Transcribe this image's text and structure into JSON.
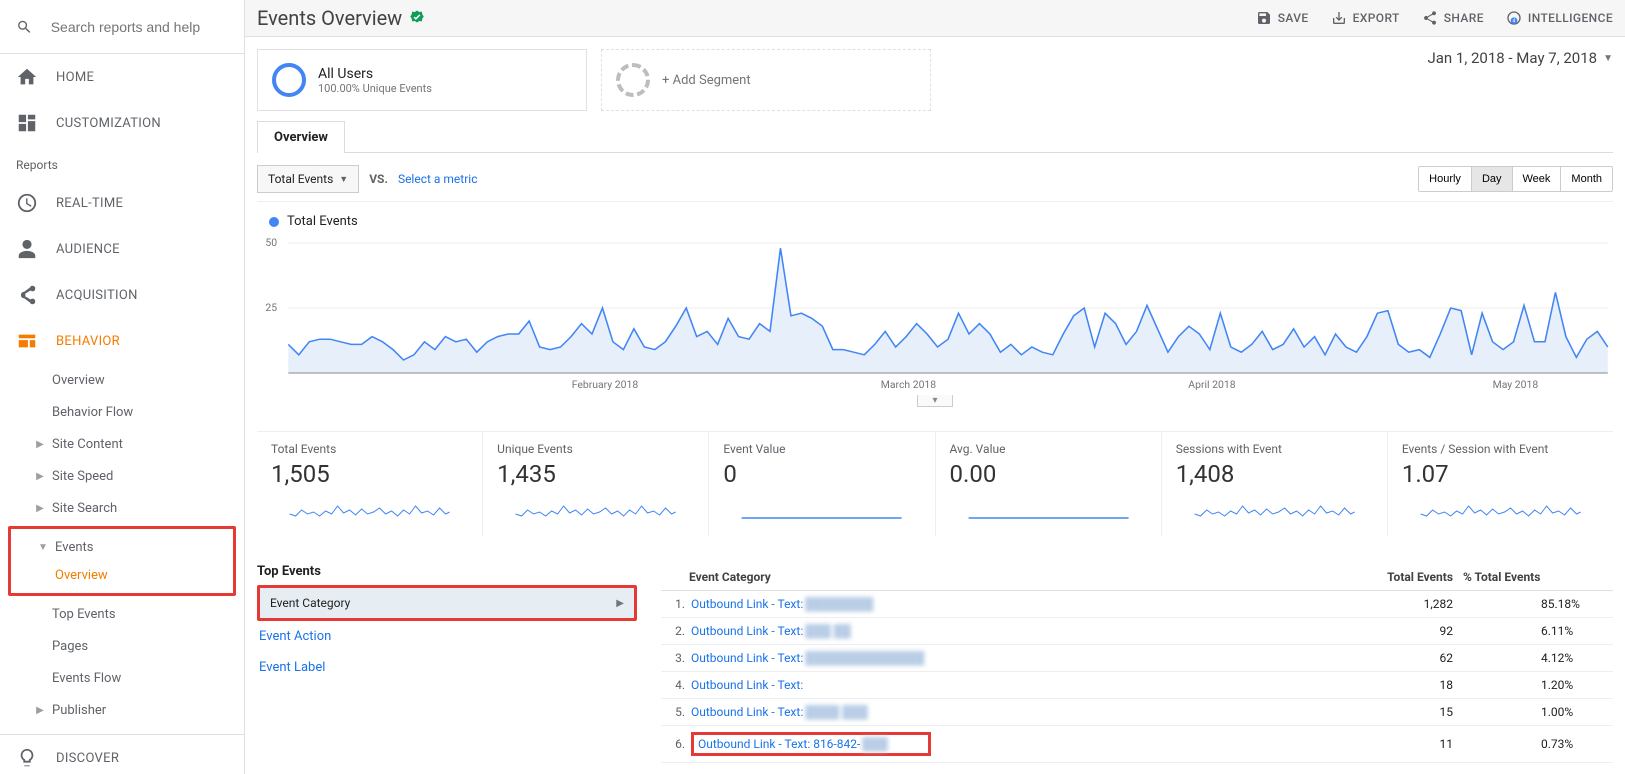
{
  "search": {
    "placeholder": "Search reports and help"
  },
  "nav": {
    "home": "HOME",
    "customization": "CUSTOMIZATION",
    "reports_label": "Reports",
    "realtime": "REAL-TIME",
    "audience": "AUDIENCE",
    "acquisition": "ACQUISITION",
    "behavior": "BEHAVIOR",
    "behavior_sub": {
      "overview": "Overview",
      "behavior_flow": "Behavior Flow",
      "site_content": "Site Content",
      "site_speed": "Site Speed",
      "site_search": "Site Search",
      "events": "Events",
      "events_overview": "Overview",
      "top_events": "Top Events",
      "pages": "Pages",
      "events_flow": "Events Flow",
      "publisher": "Publisher"
    },
    "discover": "DISCOVER"
  },
  "page": {
    "title": "Events Overview",
    "actions": {
      "save": "SAVE",
      "export": "EXPORT",
      "share": "SHARE",
      "intelligence": "INTELLIGENCE"
    }
  },
  "segments": {
    "all_users": "All Users",
    "all_users_sub": "100.00% Unique Events",
    "add": "+ Add Segment"
  },
  "date_range": "Jan 1, 2018 - May 7, 2018",
  "tab": "Overview",
  "controls": {
    "metric_dropdown": "Total Events",
    "vs": "VS.",
    "select_metric": "Select a metric",
    "granularity": {
      "hourly": "Hourly",
      "day": "Day",
      "week": "Week",
      "month": "Month"
    }
  },
  "chart": {
    "legend": "Total Events",
    "y_ticks": [
      "50",
      "25"
    ],
    "x_ticks": [
      "February 2018",
      "March 2018",
      "April 2018",
      "May 2018"
    ]
  },
  "metrics": [
    {
      "label": "Total Events",
      "value": "1,505"
    },
    {
      "label": "Unique Events",
      "value": "1,435"
    },
    {
      "label": "Event Value",
      "value": "0"
    },
    {
      "label": "Avg. Value",
      "value": "0.00"
    },
    {
      "label": "Sessions with Event",
      "value": "1,408"
    },
    {
      "label": "Events / Session with Event",
      "value": "1.07"
    }
  ],
  "top_events": {
    "title": "Top Events",
    "event_category": "Event Category",
    "event_action": "Event Action",
    "event_label": "Event Label"
  },
  "table": {
    "head": {
      "cat": "Event Category",
      "te": "Total Events",
      "pct": "% Total Events"
    },
    "rows": [
      {
        "n": "1.",
        "link": "Outbound Link - Text:",
        "blur": "████████",
        "te": "1,282",
        "pct": "85.18%",
        "bar": 85
      },
      {
        "n": "2.",
        "link": "Outbound Link - Text:",
        "blur": "███ ██",
        "te": "92",
        "pct": "6.11%",
        "bar": 6
      },
      {
        "n": "3.",
        "link": "Outbound Link - Text:",
        "blur": "██████████████",
        "te": "62",
        "pct": "4.12%",
        "bar": 4
      },
      {
        "n": "4.",
        "link": "Outbound Link - Text:",
        "blur": "",
        "te": "18",
        "pct": "1.20%",
        "bar": 2
      },
      {
        "n": "5.",
        "link": "Outbound Link - Text:",
        "blur": "████ ███",
        "te": "15",
        "pct": "1.00%",
        "bar": 2
      },
      {
        "n": "6.",
        "link": "Outbound Link - Text: 816-842-",
        "blur": "███",
        "te": "11",
        "pct": "0.73%",
        "bar": 2
      }
    ]
  },
  "chart_data": {
    "type": "line",
    "title": "Total Events",
    "ylabel": "Total Events",
    "ylim": [
      0,
      50
    ],
    "x_range": [
      "2018-01-01",
      "2018-05-07"
    ],
    "x_tick_labels": [
      "February 2018",
      "March 2018",
      "April 2018",
      "May 2018"
    ],
    "series": [
      {
        "name": "Total Events",
        "values": [
          11,
          7,
          12,
          13,
          13,
          12,
          11,
          11,
          14,
          12,
          9,
          5,
          7,
          12,
          9,
          14,
          12,
          13,
          8,
          12,
          14,
          15,
          15,
          20,
          10,
          9,
          10,
          14,
          19,
          15,
          25,
          12,
          9,
          17,
          10,
          9,
          12,
          18,
          25,
          14,
          16,
          11,
          21,
          14,
          13,
          19,
          16,
          48,
          22,
          23,
          21,
          18,
          9,
          9,
          8,
          7,
          11,
          16,
          10,
          14,
          19,
          15,
          10,
          13,
          23,
          15,
          19,
          15,
          8,
          11,
          7,
          10,
          8,
          7,
          15,
          22,
          25,
          10,
          23,
          19,
          11,
          16,
          26,
          17,
          8,
          14,
          18,
          15,
          9,
          23,
          10,
          8,
          11,
          16,
          9,
          11,
          17,
          10,
          14,
          7,
          15,
          10,
          8,
          14,
          23,
          24,
          11,
          8,
          9,
          6,
          15,
          25,
          24,
          7,
          23,
          12,
          9,
          12,
          26,
          12,
          12,
          31,
          14,
          6,
          13,
          16,
          10
        ]
      }
    ]
  }
}
